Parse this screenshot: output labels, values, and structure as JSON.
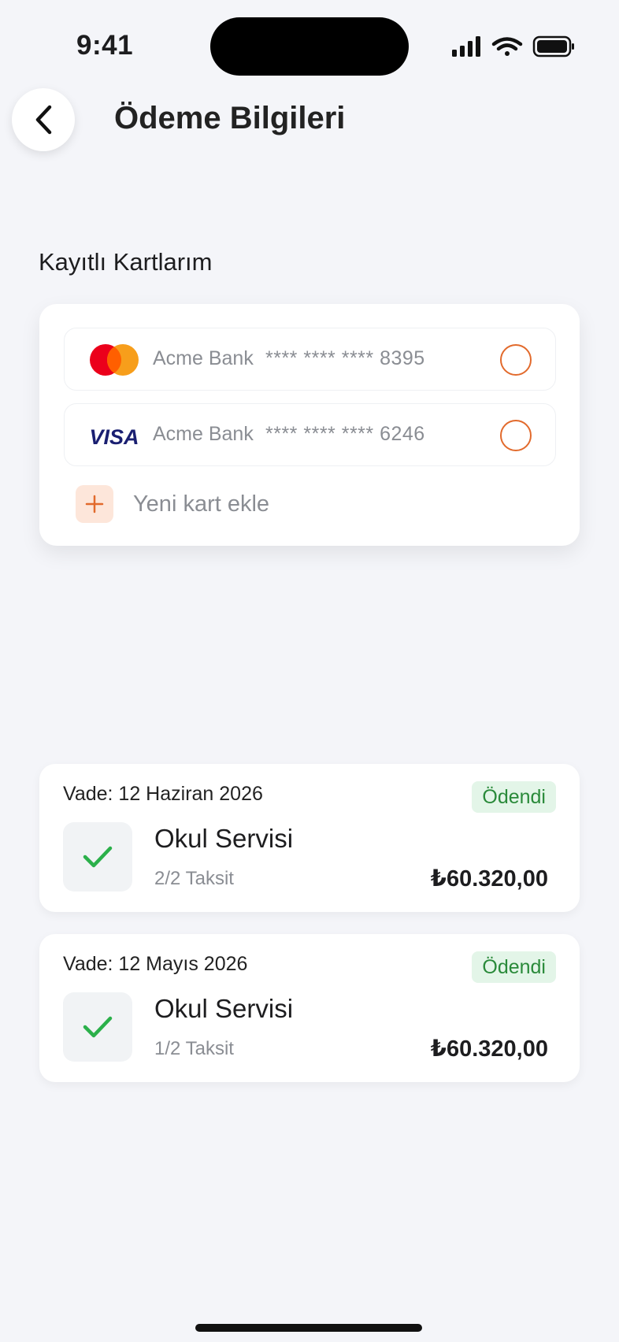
{
  "status_bar": {
    "time": "9:41"
  },
  "header": {
    "title": "Ödeme Bilgileri"
  },
  "saved_cards": {
    "title": "Kayıtlı Kartlarım",
    "cards": [
      {
        "brand": "mastercard",
        "bank": "Acme Bank",
        "number": "**** **** **** 8395"
      },
      {
        "brand": "VISA",
        "bank": "Acme Bank",
        "number": "**** **** **** 6246"
      }
    ],
    "add_label": "Yeni kart ekle"
  },
  "payments": [
    {
      "due": "Vade: 12 Haziran 2026",
      "status": "Ödendi",
      "service": "Okul Servisi",
      "installment": "2/2 Taksit",
      "amount": "₺60.320,00"
    },
    {
      "due": "Vade: 12 Mayıs 2026",
      "status": "Ödendi",
      "service": "Okul Servisi",
      "installment": "1/2 Taksit",
      "amount": "₺60.320,00"
    }
  ],
  "colors": {
    "accent": "#e26a2c",
    "success": "#2a8a3a",
    "success_bg": "#e3f5e8",
    "visa": "#1a1f71"
  },
  "icons": [
    "back-chevron-icon",
    "signal-icon",
    "wifi-icon",
    "battery-icon",
    "mastercard-logo",
    "visa-logo",
    "plus-icon",
    "check-icon"
  ]
}
